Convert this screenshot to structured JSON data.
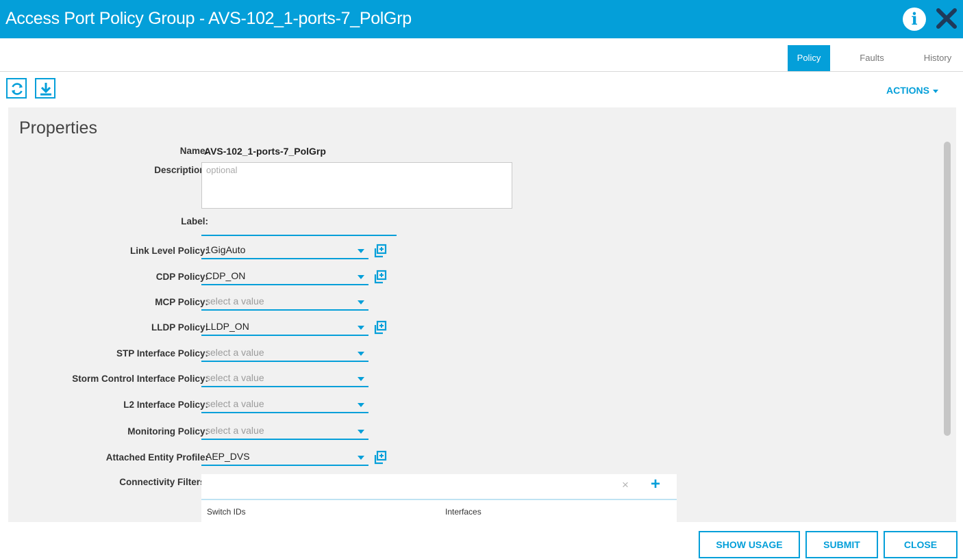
{
  "window": {
    "title": "Access Port Policy Group - AVS-102_1-ports-7_PolGrp",
    "info_glyph": "i",
    "title_bar_color": "#049fd9"
  },
  "tabs": [
    {
      "label": "Policy",
      "active": true
    },
    {
      "label": "Faults",
      "active": false
    },
    {
      "label": "History",
      "active": false
    }
  ],
  "toolbar": {
    "refresh_icon": "refresh-icon",
    "download_icon": "download-icon",
    "actions_label": "ACTIONS"
  },
  "properties": {
    "title": "Properties",
    "name": {
      "label": "Name:",
      "value": "AVS-102_1-ports-7_PolGrp"
    },
    "description": {
      "label": "Description:",
      "placeholder": "optional",
      "value": ""
    },
    "label": {
      "label": "Label:",
      "value": ""
    },
    "link_level_policy": {
      "label": "Link Level Policy:",
      "value": "1GigAuto"
    },
    "cdp_policy": {
      "label": "CDP Policy:",
      "value": "CDP_ON"
    },
    "mcp_policy": {
      "label": "MCP Policy:",
      "value": "select a value"
    },
    "lldp_policy": {
      "label": "LLDP Policy:",
      "value": "LLDP_ON"
    },
    "stp_interface_policy": {
      "label": "STP Interface Policy:",
      "value": "select a value"
    },
    "storm_control_interface_policy": {
      "label": "Storm Control Interface Policy:",
      "value": "select a value"
    },
    "l2_interface_policy": {
      "label": "L2 Interface Policy:",
      "value": "select a value"
    },
    "monitoring_policy": {
      "label": "Monitoring Policy:",
      "value": "select a value"
    },
    "attached_entity_profile": {
      "label": "Attached Entity Profile:",
      "value": "AEP_DVS"
    },
    "connectivity_filters": {
      "label": "Connectivity Filters:",
      "clear_glyph": "×",
      "add_glyph": "+",
      "columns": [
        "Switch IDs",
        "Interfaces"
      ]
    }
  },
  "footer": {
    "show_usage": "SHOW USAGE",
    "submit": "SUBMIT",
    "close": "CLOSE"
  },
  "colors": {
    "accent": "#049fd9",
    "panel_background": "#f1f1f1",
    "placeholder_text": "#9b9b9b"
  }
}
